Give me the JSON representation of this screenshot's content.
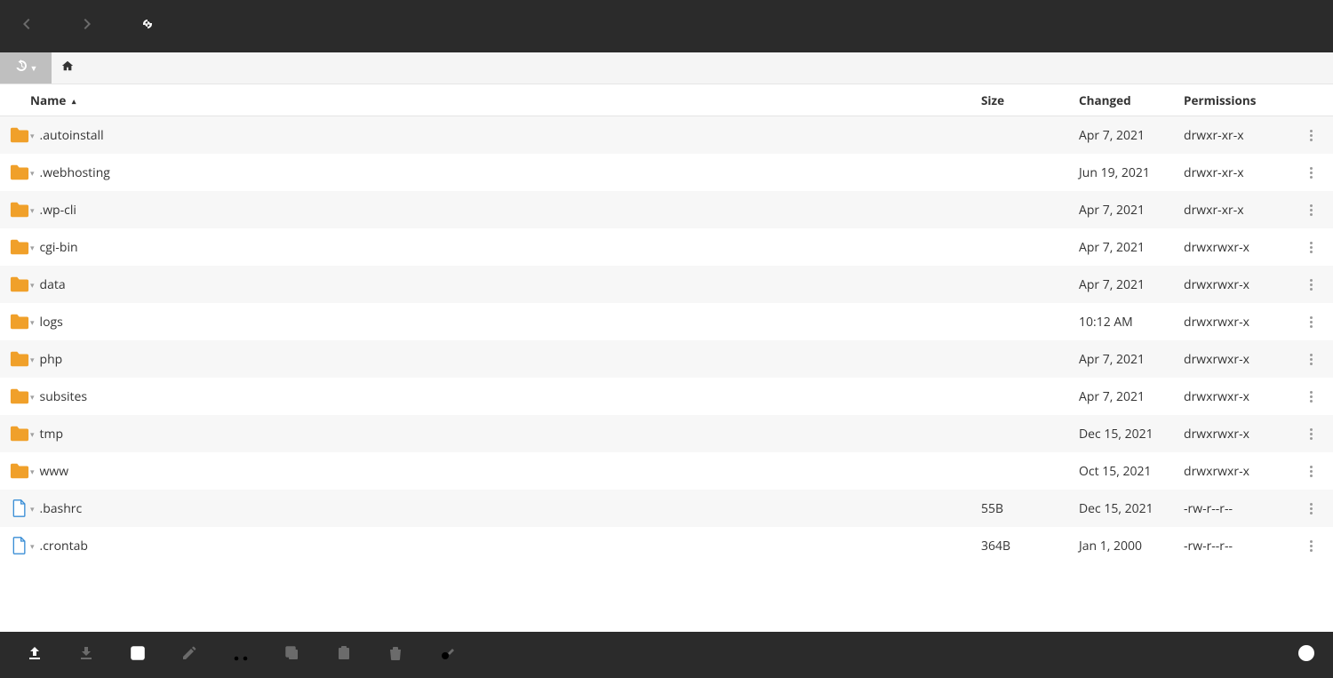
{
  "columns": {
    "name": "Name",
    "size": "Size",
    "changed": "Changed",
    "permissions": "Permissions"
  },
  "sort": {
    "column": "name",
    "dir": "asc"
  },
  "rows": [
    {
      "type": "folder",
      "name": ".autoinstall",
      "size": "",
      "changed": "Apr 7, 2021",
      "perm": "drwxr-xr-x"
    },
    {
      "type": "folder",
      "name": ".webhosting",
      "size": "",
      "changed": "Jun 19, 2021",
      "perm": "drwxr-xr-x"
    },
    {
      "type": "folder",
      "name": ".wp-cli",
      "size": "",
      "changed": "Apr 7, 2021",
      "perm": "drwxr-xr-x"
    },
    {
      "type": "folder",
      "name": "cgi-bin",
      "size": "",
      "changed": "Apr 7, 2021",
      "perm": "drwxrwxr-x"
    },
    {
      "type": "folder",
      "name": "data",
      "size": "",
      "changed": "Apr 7, 2021",
      "perm": "drwxrwxr-x"
    },
    {
      "type": "folder",
      "name": "logs",
      "size": "",
      "changed": "10:12 AM",
      "perm": "drwxrwxr-x"
    },
    {
      "type": "folder",
      "name": "php",
      "size": "",
      "changed": "Apr 7, 2021",
      "perm": "drwxrwxr-x"
    },
    {
      "type": "folder",
      "name": "subsites",
      "size": "",
      "changed": "Apr 7, 2021",
      "perm": "drwxrwxr-x"
    },
    {
      "type": "folder",
      "name": "tmp",
      "size": "",
      "changed": "Dec 15, 2021",
      "perm": "drwxrwxr-x"
    },
    {
      "type": "folder",
      "name": "www",
      "size": "",
      "changed": "Oct 15, 2021",
      "perm": "drwxrwxr-x"
    },
    {
      "type": "file",
      "name": ".bashrc",
      "size": "55B",
      "changed": "Dec 15, 2021",
      "perm": "-rw-r--r--"
    },
    {
      "type": "file",
      "name": ".crontab",
      "size": "364B",
      "changed": "Jan 1, 2000",
      "perm": "-rw-r--r--"
    }
  ],
  "toolbar": {
    "back": {
      "name": "back",
      "enabled": false
    },
    "forward": {
      "name": "forward",
      "enabled": false
    },
    "refresh": {
      "name": "refresh",
      "enabled": true
    }
  },
  "bottom_tools": [
    {
      "name": "upload",
      "enabled": true
    },
    {
      "name": "download",
      "enabled": false
    },
    {
      "name": "new",
      "enabled": true
    },
    {
      "name": "edit",
      "enabled": false
    },
    {
      "name": "cut",
      "enabled": false
    },
    {
      "name": "copy",
      "enabled": false
    },
    {
      "name": "paste",
      "enabled": false
    },
    {
      "name": "delete",
      "enabled": false
    },
    {
      "name": "rename",
      "enabled": false
    }
  ],
  "colors": {
    "folder": "#f0a02a",
    "file_stroke": "#3a8ed6"
  }
}
